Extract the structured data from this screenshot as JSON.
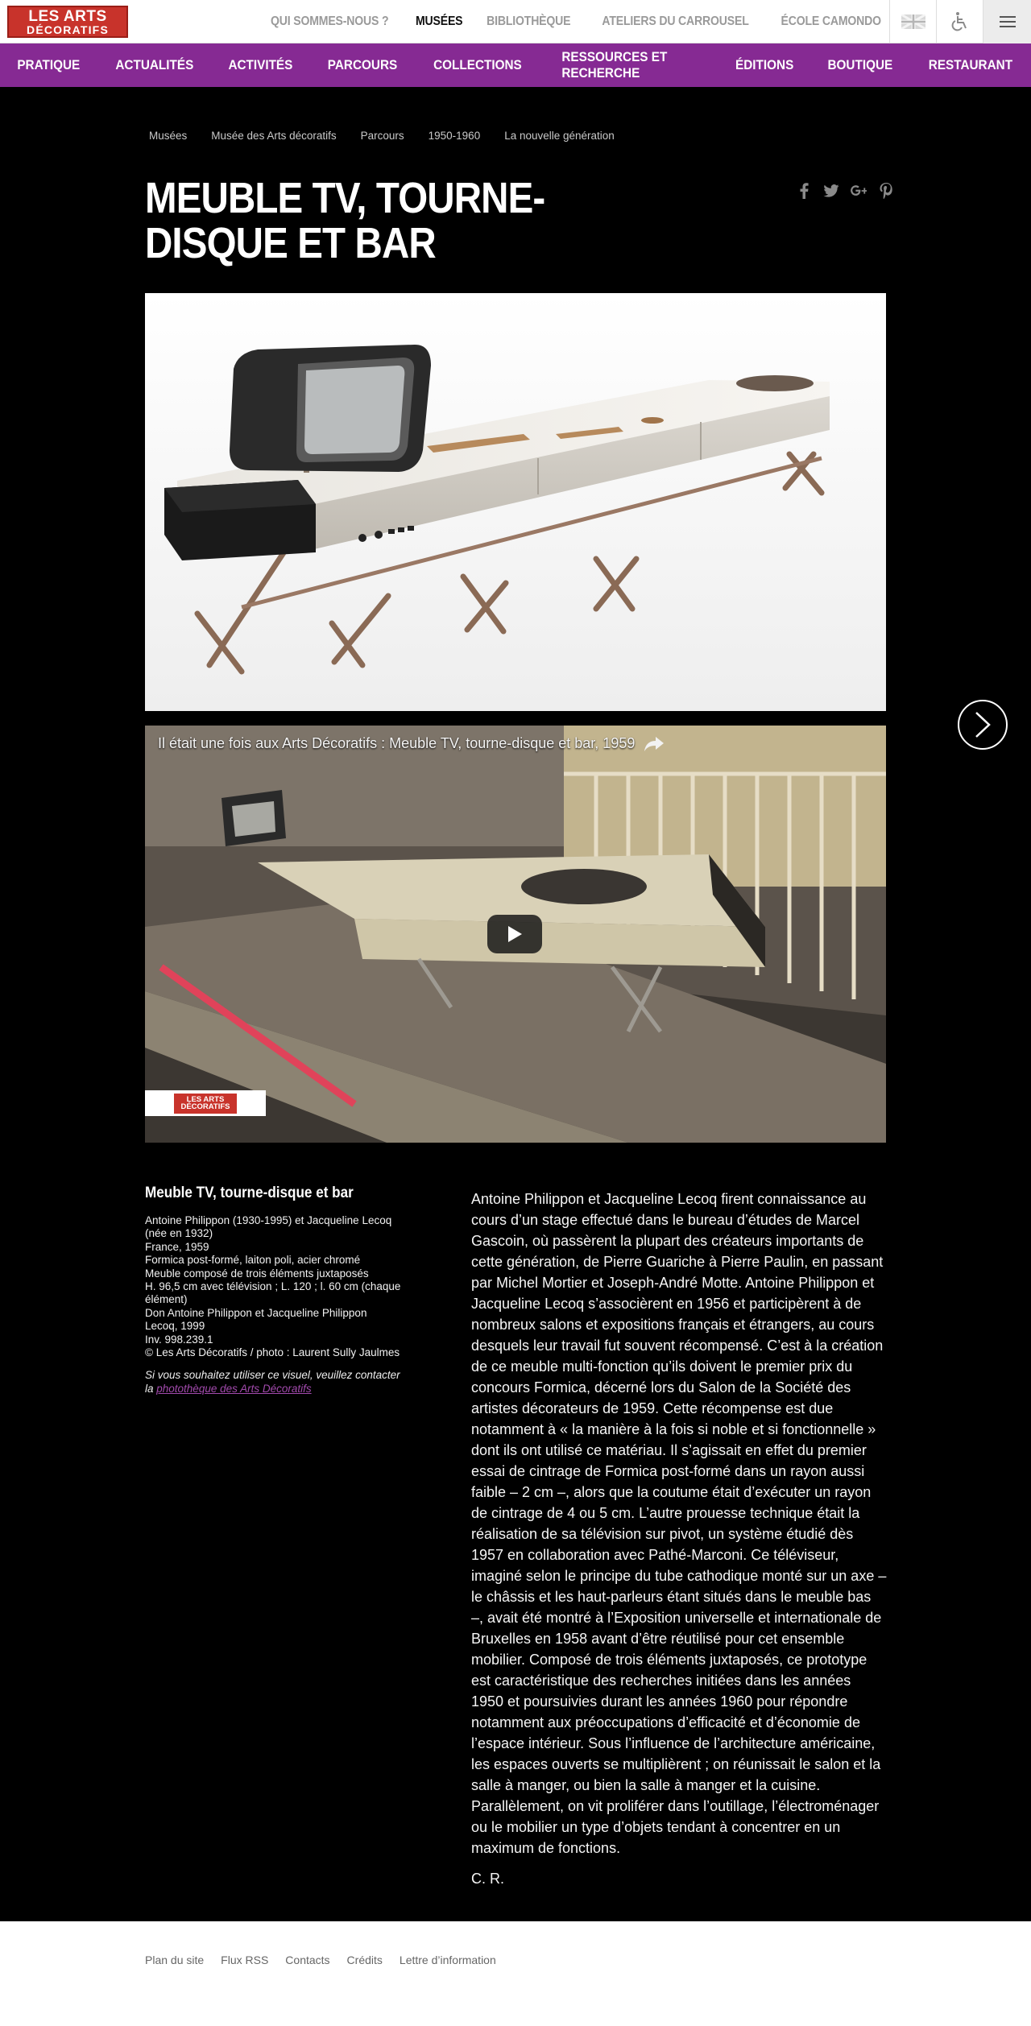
{
  "header": {
    "logo_line1": "LES ARTS",
    "logo_line2": "DÉCORATIFS",
    "top_links": [
      "QUI SOMMES-NOUS ?",
      "MUSÉES",
      "BIBLIOTHÈQUE",
      "ATELIERS DU CARROUSEL",
      "ÉCOLE CAMONDO"
    ],
    "active_top_link": "MUSÉES",
    "icons": [
      "uk-flag-icon",
      "accessibility-icon",
      "hamburger-menu-icon"
    ]
  },
  "main_nav": [
    "PRATIQUE",
    "ACTUALITÉS",
    "ACTIVITÉS",
    "PARCOURS",
    "COLLECTIONS",
    "RESSOURCES ET RECHERCHE",
    "ÉDITIONS",
    "BOUTIQUE",
    "RESTAURANT"
  ],
  "breadcrumb": [
    "Musées",
    "Musée des Arts décoratifs",
    "Parcours",
    "1950-1960",
    "La nouvelle génération"
  ],
  "page_title": "MEUBLE TV, TOURNE-DISQUE ET BAR",
  "share_icons": [
    "facebook-icon",
    "twitter-icon",
    "google-plus-icon",
    "pinterest-icon"
  ],
  "video": {
    "title": "Il était une fois aux Arts Décoratifs : Meuble TV, tourne-disque et bar, 1959",
    "watermark_line1": "LES ARTS",
    "watermark_line2": "DÉCORATIFS"
  },
  "caption": {
    "heading": "Meuble TV, tourne-disque et bar",
    "lines": [
      "Antoine Philippon (1930-1995) et Jacqueline Lecoq",
      "(née en 1932)",
      "France, 1959",
      "Formica post-formé, laiton poli, acier chromé",
      "Meuble composé de trois éléments juxtaposés",
      "H. 96,5 cm avec télévision ; L. 120 ; l. 60 cm (chaque",
      "élément)",
      "Don Antoine Philippon et Jacqueline Philippon",
      "Lecoq, 1999",
      "Inv. 998.239.1",
      "© Les Arts Décoratifs / photo : Laurent Sully Jaulmes"
    ],
    "note_prefix": "Si vous souhaitez utiliser ce visuel, veuillez contacter la ",
    "note_link": "photothèque des Arts Décoratifs"
  },
  "body": {
    "paragraph": "Antoine Philippon et Jacqueline Lecoq firent connaissance au cours d’un stage effectué dans le bureau d’études de Marcel Gascoin, où passèrent la plupart des créateurs importants de cette génération, de Pierre Guariche à Pierre Paulin, en passant par Michel Mortier et Joseph-André Motte. Antoine Philippon et Jacqueline Lecoq s’associèrent en 1956 et participèrent à de nombreux salons et expositions français et étrangers, au cours desquels leur travail fut souvent récompensé. C’est à la création de ce meuble multi-fonction qu’ils doivent le premier prix du concours Formica, décerné lors du Salon de la Société des artistes décorateurs de 1959. Cette récompense est due notamment à « la manière à la fois si noble et si fonctionnelle » dont ils ont utilisé ce matériau. Il s’agissait en effet du premier essai de cintrage de Formica post-formé dans un rayon aussi faible – 2 cm –, alors que la coutume était d’exécuter un rayon de cintrage de 4 ou 5 cm. L’autre prouesse technique était la réalisation de sa télévision sur pivot, un système étudié dès 1957 en collaboration avec Pathé-Marconi. Ce téléviseur, imaginé selon le principe du tube cathodique monté sur un axe – le châssis et les haut-parleurs étant situés dans le meuble bas –, avait été montré à l’Exposition universelle et internationale de Bruxelles en 1958 avant d’être réutilisé pour cet ensemble mobilier. Composé de trois éléments juxtaposés, ce prototype est caractéristique des recherches initiées dans les années 1950 et poursuivies durant les années 1960 pour répondre notamment aux préoccupations d’efficacité et d’économie de l’espace intérieur. Sous l’influence de l’architecture américaine, les espaces ouverts se multiplièrent ; on réunissait le salon et la salle à manger, ou bien la salle à manger et la cuisine. Parallèlement, on vit proliférer dans l’outillage, l’électroménager ou le mobilier un type d’objets tendant à concentrer en un maximum de fonctions.",
    "signature": "C. R."
  },
  "footer": {
    "links": [
      "Plan du site",
      "Flux RSS",
      "Contacts",
      "Crédits",
      "Lettre d’information"
    ]
  }
}
